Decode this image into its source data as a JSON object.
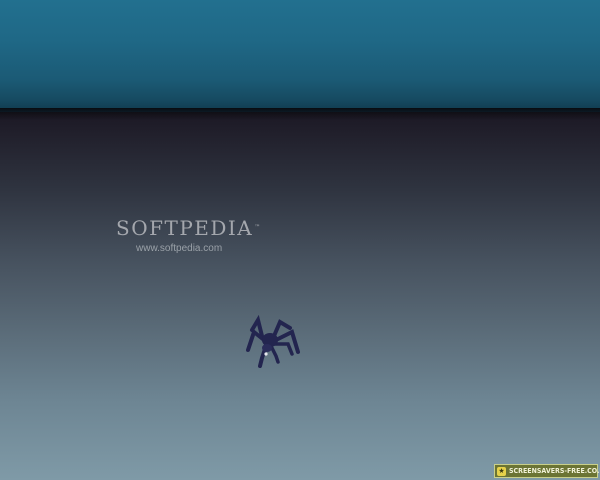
{
  "watermark": {
    "name": "SOFTPEDIA",
    "trademark": "™",
    "url": "www.softpedia.com"
  },
  "badge": {
    "label": "SCREENSAVERS-FREE.CO.UK",
    "icon": "screensaver-logo-icon"
  },
  "colors": {
    "top_band": "#1f6886",
    "background_top": "#1d1a26",
    "background_bottom": "#7f9aa7",
    "spider": "#23254f",
    "badge": "#6b7434"
  }
}
